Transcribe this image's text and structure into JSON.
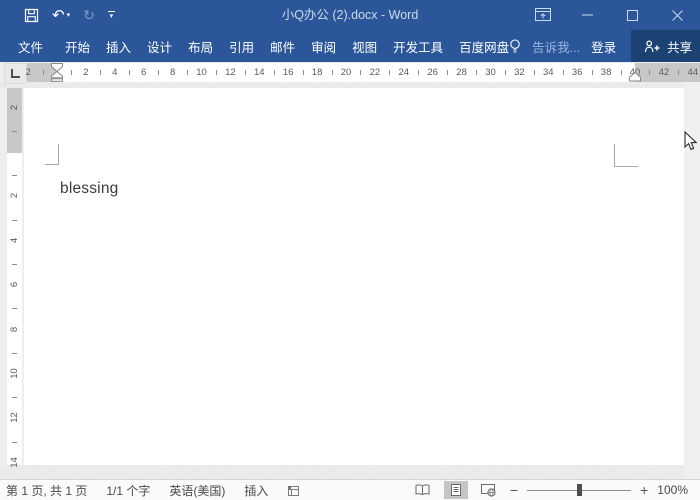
{
  "window": {
    "title": "小Q办公 (2).docx - Word"
  },
  "ribbon": {
    "tabs": [
      {
        "name": "file",
        "label": "文件"
      },
      {
        "name": "home",
        "label": "开始"
      },
      {
        "name": "insert",
        "label": "插入"
      },
      {
        "name": "design",
        "label": "设计"
      },
      {
        "name": "layout",
        "label": "布局"
      },
      {
        "name": "references",
        "label": "引用"
      },
      {
        "name": "mailings",
        "label": "邮件"
      },
      {
        "name": "review",
        "label": "审阅"
      },
      {
        "name": "view",
        "label": "视图"
      },
      {
        "name": "developer",
        "label": "开发工具"
      },
      {
        "name": "baidu-netdisk",
        "label": "百度网盘"
      }
    ],
    "tell_me": "告诉我...",
    "sign_in": "登录",
    "share": "共享"
  },
  "ruler": {
    "horizontal": {
      "left_margin_labels": [
        2
      ],
      "text_area_labels": [
        2,
        4,
        6,
        8,
        10,
        12,
        14,
        16,
        18,
        20,
        22,
        24,
        26,
        28,
        30,
        32,
        34,
        36,
        38
      ],
      "right_margin_labels": [
        40,
        42,
        44
      ]
    },
    "vertical": {
      "top_margin_labels": [
        2
      ],
      "text_area_labels": [
        2,
        4,
        6,
        8,
        10,
        12,
        14
      ]
    }
  },
  "document": {
    "text": "blessing"
  },
  "status_bar": {
    "page_info": "第 1 页, 共 1 页",
    "word_count": "1/1 个字",
    "language": "英语(美国)",
    "insert_mode": "插入",
    "zoom_level": "100%"
  },
  "colors": {
    "titlebar_blue": "#2b579a",
    "share_button_blue": "#1b4273",
    "ruler_margin_gray": "#c9c8c8"
  }
}
